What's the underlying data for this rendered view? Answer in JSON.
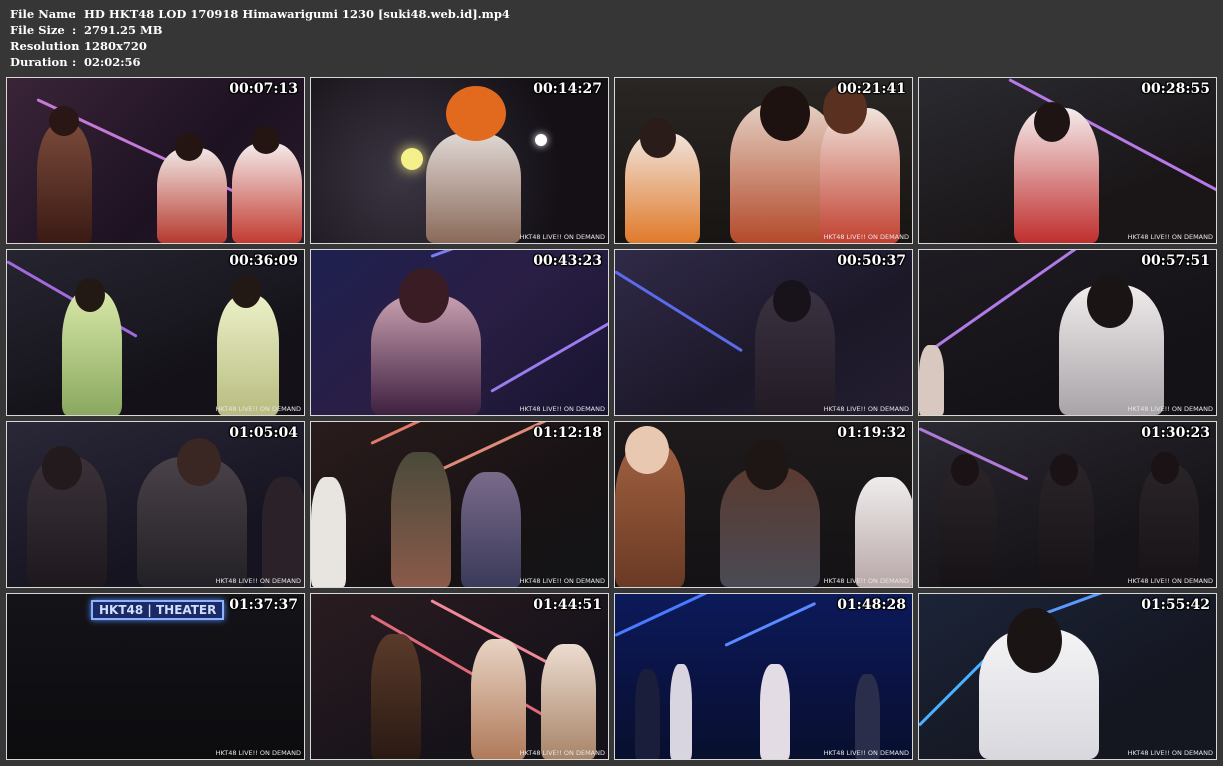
{
  "info": [
    {
      "key": "File Name",
      "value": "HD HKT48 LOD 170918 Himawarigumi 1230 [suki48.web.id].mp4"
    },
    {
      "key": "File Size",
      "value": "2791.25 MB"
    },
    {
      "key": "Resolution",
      "value": "1280x720"
    },
    {
      "key": "Duration",
      "value": "02:02:56"
    }
  ],
  "watermark": "HKT48 LIVE!! ON DEMAND",
  "theater_sign": "HKT48 | THEATER",
  "thumbnails": [
    {
      "time": "00:07:13",
      "watermark": ""
    },
    {
      "time": "00:14:27",
      "watermark": "HKT48 LIVE!! ON DEMAND"
    },
    {
      "time": "00:21:41",
      "watermark": "HKT48 LIVE!! ON DEMAND"
    },
    {
      "time": "00:28:55",
      "watermark": "HKT48 LIVE!! ON DEMAND"
    },
    {
      "time": "00:36:09",
      "watermark": "HKT48 LIVE!! ON DEMAND"
    },
    {
      "time": "00:43:23",
      "watermark": "HKT48 LIVE!! ON DEMAND"
    },
    {
      "time": "00:50:37",
      "watermark": "HKT48 LIVE!! ON DEMAND"
    },
    {
      "time": "00:57:51",
      "watermark": "HKT48 LIVE!! ON DEMAND"
    },
    {
      "time": "01:05:04",
      "watermark": "HKT48 LIVE!! ON DEMAND"
    },
    {
      "time": "01:12:18",
      "watermark": "HKT48 LIVE!! ON DEMAND"
    },
    {
      "time": "01:19:32",
      "watermark": "HKT48 LIVE!! ON DEMAND"
    },
    {
      "time": "01:30:23",
      "watermark": "HKT48 LIVE!! ON DEMAND"
    },
    {
      "time": "01:37:37",
      "watermark": "HKT48 LIVE!! ON DEMAND"
    },
    {
      "time": "01:44:51",
      "watermark": "HKT48 LIVE!! ON DEMAND"
    },
    {
      "time": "01:48:28",
      "watermark": "HKT48 LIVE!! ON DEMAND"
    },
    {
      "time": "01:55:42",
      "watermark": "HKT48 LIVE!! ON DEMAND"
    }
  ]
}
